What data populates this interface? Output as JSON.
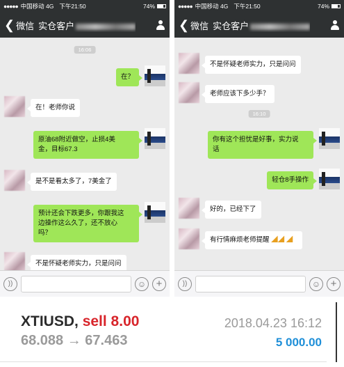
{
  "status_bar": {
    "carrier": "中国移动 4G",
    "time": "下午21:50",
    "battery": "74%"
  },
  "nav": {
    "back_label": "微信",
    "title": "实仓客户",
    "title_suffix": "7万美金"
  },
  "left_chat": {
    "time_1": "16:06",
    "msg_1": "在？",
    "msg_2": "在！老师你说",
    "msg_3_l1": "原油68附近做空，止损4美",
    "msg_3_l2": "金，目标67.3",
    "msg_4": "是不是看太多了，7美金了",
    "msg_5_l1": "预计还会下跌更多，你跟我这",
    "msg_5_l2": "边操作这么久了，还不放心",
    "msg_5_l3": "吗？",
    "msg_6": "不是怀疑老师实力，只是问问"
  },
  "right_chat": {
    "msg_1": "不是怀疑老师实力，只是问问",
    "msg_2": "老师应该下多少手？",
    "time_1": "16:10",
    "msg_3_l1": "你有这个担忧是好事，实力说",
    "msg_3_l2": "话",
    "msg_4": "轻仓8手操作",
    "msg_5": "好的，已经下了",
    "msg_6": "有行情麻烦老师提醒"
  },
  "icons": {
    "voice": "voice-icon",
    "emoji": "emoji-icon",
    "plus": "plus-icon",
    "back": "back-chevron-icon",
    "profile": "person-icon",
    "clap": "clap-emoji-icon"
  },
  "trade": {
    "symbol": "XTIUSD,",
    "action": "sell 8.00",
    "price_open": "68.088",
    "arrow": "→",
    "price_close": "67.463",
    "datetime": "2018.04.23 16:12",
    "profit": "5 000.00"
  },
  "colors": {
    "nav_bg": "#2e3132",
    "chat_bg": "#ebebeb",
    "bubble_out": "#9fe658",
    "sell": "#d8252b",
    "profit": "#1f8fd8"
  }
}
